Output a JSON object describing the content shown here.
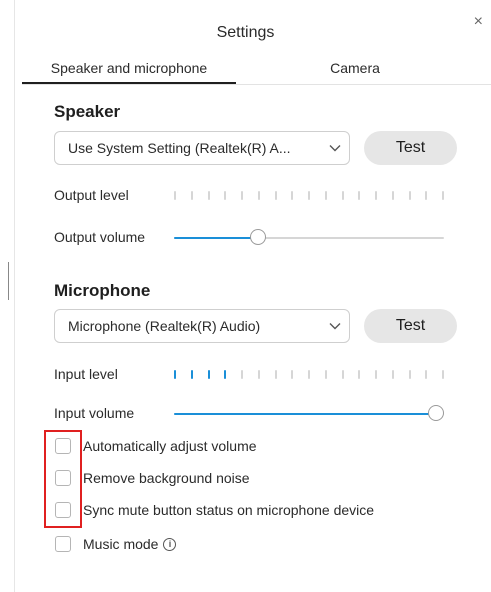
{
  "window": {
    "title": "Settings",
    "close_label": "×"
  },
  "tabs": [
    {
      "label": "Speaker and microphone",
      "active": true
    },
    {
      "label": "Camera",
      "active": false
    }
  ],
  "speaker": {
    "heading": "Speaker",
    "device_value": "Use System Setting (Realtek(R) A...",
    "test_label": "Test",
    "output_level_label": "Output level",
    "output_level_active_bars": 0,
    "output_volume_label": "Output volume",
    "output_volume_fraction": 0.32
  },
  "microphone": {
    "heading": "Microphone",
    "device_value": "Microphone (Realtek(R) Audio)",
    "test_label": "Test",
    "input_level_label": "Input level",
    "input_level_active_bars": 4,
    "input_volume_label": "Input volume",
    "input_volume_fraction": 1.0
  },
  "options": [
    {
      "label": "Automatically adjust volume",
      "checked": false
    },
    {
      "label": "Remove background noise",
      "checked": false
    },
    {
      "label": "Sync mute button status on microphone device",
      "checked": false
    },
    {
      "label": "Music mode",
      "checked": false,
      "has_info_icon": true
    }
  ],
  "meter_bar_count": 17,
  "colors": {
    "accent": "#1a8fd8",
    "highlight_box": "#e02020"
  },
  "icons": {
    "close": "close-icon",
    "dropdown": "chevron-down-icon",
    "info": "info-icon"
  }
}
